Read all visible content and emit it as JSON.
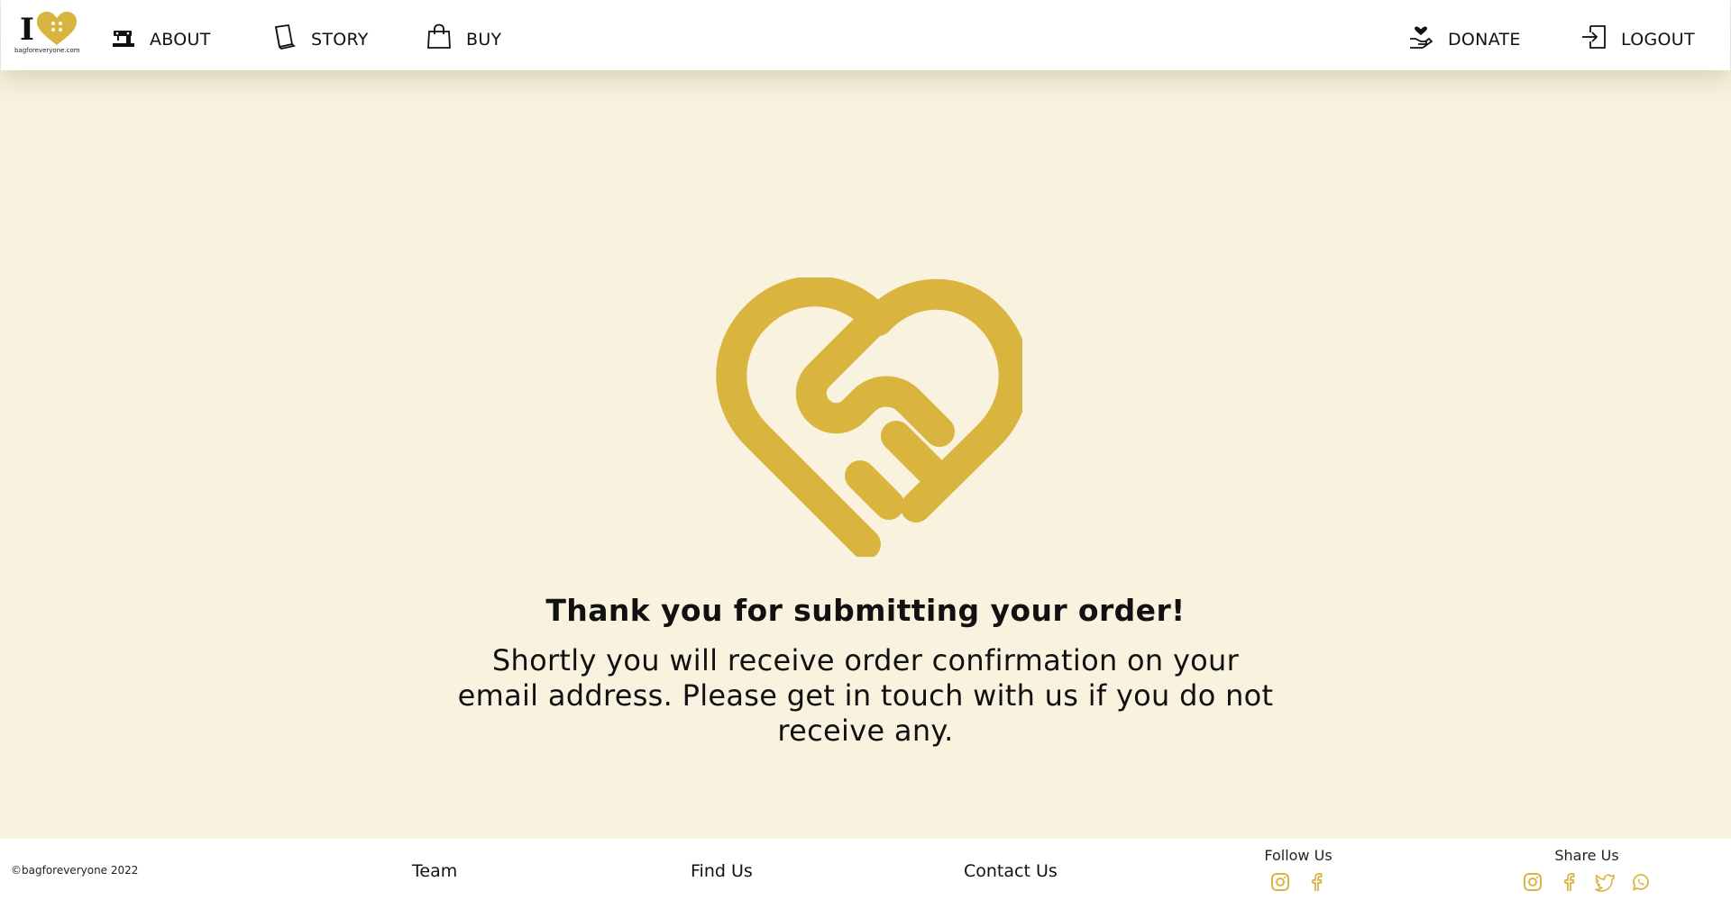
{
  "header": {
    "logo_caption": "bagforeveryone.com",
    "nav_left": [
      {
        "label": "ABOUT",
        "icon": "sewing-machine-icon"
      },
      {
        "label": "STORY",
        "icon": "book-icon"
      },
      {
        "label": "BUY",
        "icon": "shopping-bag-icon"
      }
    ],
    "nav_right": [
      {
        "label": "DONATE",
        "icon": "donate-hand-heart-icon"
      },
      {
        "label": "LOGOUT",
        "icon": "logout-icon"
      }
    ]
  },
  "main": {
    "icon": "heart-handshake-icon",
    "title": "Thank you for submitting your order!",
    "message": "Shortly you will receive order confirmation on your email address. Please get in touch with us if you do not receive any."
  },
  "footer": {
    "copyright": "©bagforeveryone 2022",
    "links": [
      "Team",
      "Find Us",
      "Contact Us"
    ],
    "follow": {
      "title": "Follow Us",
      "icons": [
        "instagram-icon",
        "facebook-icon"
      ]
    },
    "share": {
      "title": "Share Us",
      "icons": [
        "instagram-icon",
        "facebook-icon",
        "twitter-icon",
        "whatsapp-icon"
      ]
    }
  },
  "colors": {
    "accent": "#d9b43f",
    "background": "#f8f2df",
    "surface": "#ffffff",
    "text": "#111111"
  }
}
